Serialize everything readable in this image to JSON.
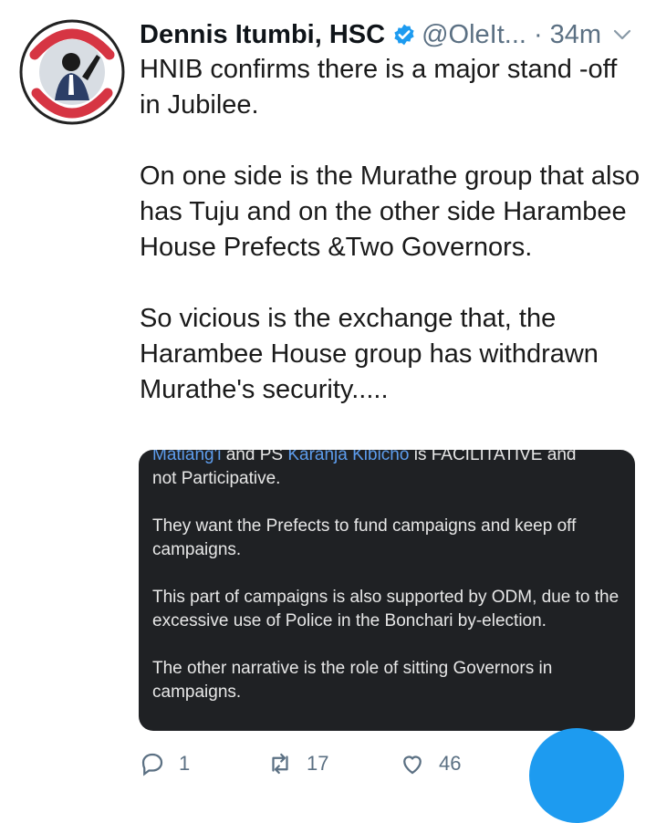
{
  "tweet": {
    "author_name": "Dennis Itumbi, HSC",
    "handle": "@OleIt...",
    "separator": "·",
    "time": "34m",
    "avatar_text_top": "I'VE GOT",
    "avatar_text_bottom": "YOUR BACK",
    "paragraphs": [
      "HNIB confirms there is a major stand -off in Jubilee.",
      "On one side is the Murathe group that also has Tuju and on the other side Harambee House Prefects &Two Governors.",
      "So vicious is the exchange that, the Harambee House group has withdrawn Murathe's security....."
    ]
  },
  "embedded_image": {
    "line1_link1": "Matiang'i",
    "line1_mid": " and PS ",
    "line1_link2": "Karanja Kibicho",
    "line1_rest": " is FACILITATIVE and",
    "line2": "not Participative.",
    "para2": "They want the Prefects to fund campaigns and keep off campaigns.",
    "para3": "This part of campaigns is also supported by ODM, due to the excessive use of Police in the Bonchari by-election.",
    "para4": "The other narrative is the role of sitting Governors in campaigns."
  },
  "actions": {
    "reply_count": "1",
    "retweet_count": "17",
    "like_count": "46"
  },
  "colors": {
    "verified": "#1d9bf0",
    "secondary_text": "#5b7083",
    "card_bg": "#1f2124",
    "link": "#5d9cec",
    "fab": "#1d9bf0"
  }
}
